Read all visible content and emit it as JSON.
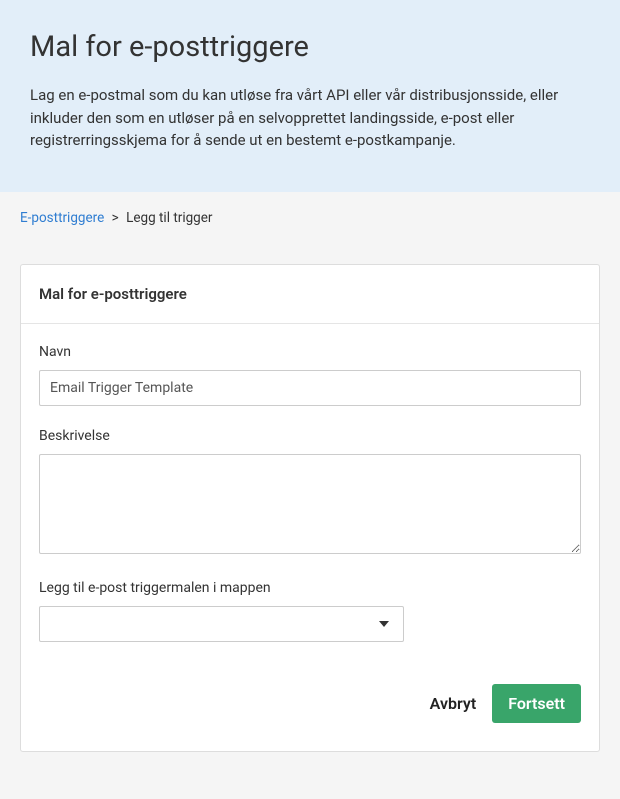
{
  "header": {
    "title": "Mal for e-posttriggere",
    "description": "Lag en e-postmal som du kan utløse fra vårt API eller vår distribusjonsside, eller inkluder den som en utløser på en selvopprettet landingsside, e-post eller registrerringsskjema for å sende ut en bestemt e-postkampanje."
  },
  "breadcrumb": {
    "link_label": "E-posttriggere",
    "separator": ">",
    "current": "Legg til trigger"
  },
  "card": {
    "title": "Mal for e-posttriggere"
  },
  "form": {
    "name_label": "Navn",
    "name_value": "Email Trigger Template",
    "description_label": "Beskrivelse",
    "description_value": "",
    "folder_label": "Legg til e-post triggermalen i mappen",
    "folder_value": ""
  },
  "actions": {
    "cancel": "Avbryt",
    "continue": "Fortsett"
  }
}
